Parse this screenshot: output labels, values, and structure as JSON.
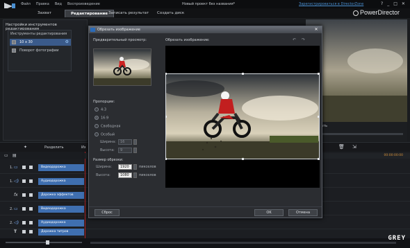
{
  "app": {
    "brand": "PowerDirector",
    "window_title": "Новый проект без названия*",
    "register_link": "Зарегистрироваться в DirectorZone",
    "menu": [
      "Файл",
      "Правка",
      "Вид",
      "Воспроизведение"
    ],
    "tabs": [
      {
        "label": "Захват",
        "active": false
      },
      {
        "label": "Редактирование",
        "active": true
      },
      {
        "label": "Записать результат",
        "active": false
      },
      {
        "label": "Создать диск",
        "active": false
      }
    ]
  },
  "left_panel": {
    "title": "Настройки инструментов редактирования",
    "box_title": "Инструменты редактирования",
    "items": [
      {
        "label": "10 x 30",
        "selected": true
      },
      {
        "label": "Поворот фотографии",
        "selected": false
      }
    ]
  },
  "right_preview": {
    "control_label": "ать"
  },
  "toolbar": {
    "split_label": "Разделить",
    "cut_label": "Из"
  },
  "timeline": {
    "ruler_mark": "00:00:00:00",
    "tracks": [
      {
        "num": "1.",
        "icon": "video-icon",
        "label": "Видеодорожка"
      },
      {
        "num": "1.",
        "icon": "audio-icon",
        "label": "Аудиодорожка"
      },
      {
        "num": "",
        "icon": "fx-icon",
        "label": "Дорожка эффектов"
      },
      {
        "num": "2.",
        "icon": "video-icon",
        "label": "Видеодорожка"
      },
      {
        "num": "2.",
        "icon": "audio-icon",
        "label": "Аудиодорожка"
      },
      {
        "num": "",
        "icon": "text-icon",
        "label": "Дорожка титров"
      }
    ]
  },
  "dialog": {
    "title": "Обрезать изображение",
    "preview_label": "Предварительный просмотр:",
    "crop_label": "Обрезать изображение:",
    "aspect_label": "Пропорции:",
    "aspect_options": [
      {
        "label": "4:3",
        "checked": false
      },
      {
        "label": "16:9",
        "checked": true
      },
      {
        "label": "Свободная",
        "checked": false
      },
      {
        "label": "Особый",
        "checked": false
      }
    ],
    "custom_width_label": "Ширина:",
    "custom_width_value": "16",
    "custom_height_label": "Высота:",
    "custom_height_value": "9",
    "size_label": "Размер обрезки:",
    "width_label": "Ширина:",
    "width_value": "1920",
    "height_label": "Высота:",
    "height_value": "1080",
    "unit": "пикселов",
    "reset_button": "Сброс",
    "ok_button": "OK",
    "cancel_button": "Отмена"
  },
  "watermark": "GREY"
}
